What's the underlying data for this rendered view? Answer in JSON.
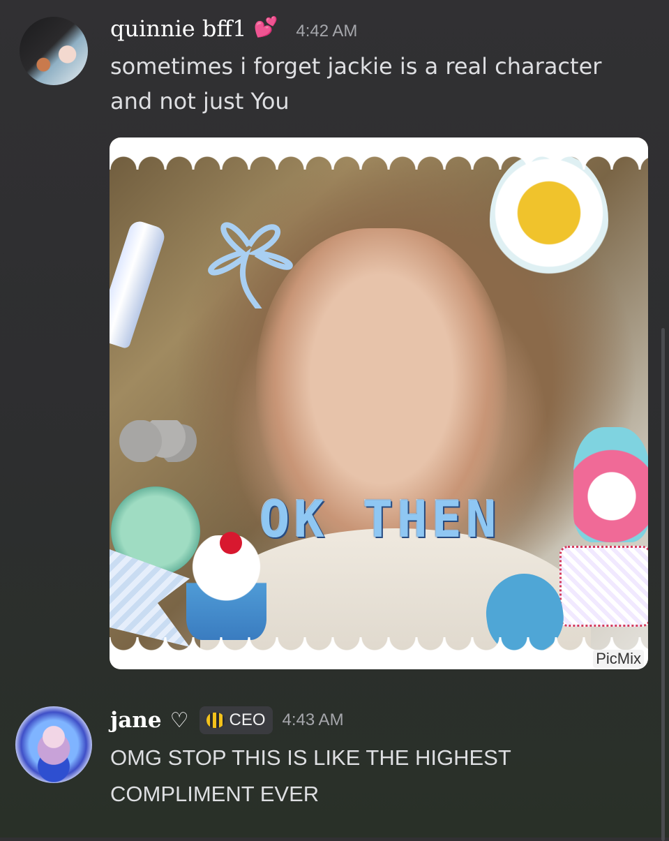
{
  "messages": [
    {
      "username": "quinnie bff1",
      "username_emoji": "💕",
      "timestamp": "4:42 AM",
      "text_lines": [
        "sometimes i forget jackie is a real character",
        "and not just You"
      ],
      "attachment": {
        "overlay_text": "OK THEN",
        "watermark": "PicMix"
      }
    },
    {
      "username": "jane",
      "username_emoji": "♡",
      "role_badge": {
        "icon": "bee-icon",
        "label": "CEO"
      },
      "timestamp": "4:43 AM",
      "text_lines": [
        "OMG STOP THIS IS LIKE THE HIGHEST",
        "COMPLIMENT EVER"
      ]
    }
  ],
  "colors": {
    "background": "#2f2f31",
    "username": "#ffffff",
    "timestamp": "#a5a6ab",
    "text": "#dedfe2",
    "heart_emoji": "#ff5aa8"
  }
}
